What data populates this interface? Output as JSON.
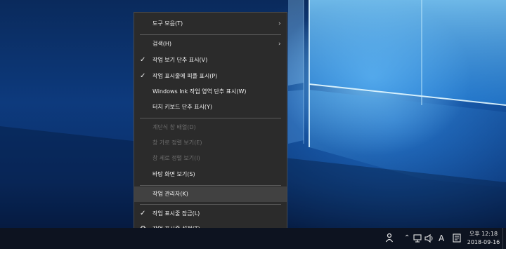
{
  "context_menu": {
    "items": [
      {
        "label": "도구 모음(T)",
        "checked": false,
        "submenu": true,
        "disabled": false
      },
      {
        "label": "검색(H)",
        "checked": false,
        "submenu": true,
        "disabled": false
      },
      {
        "label": "작업 보기 단추 표시(V)",
        "checked": true,
        "submenu": false,
        "disabled": false
      },
      {
        "label": "작업 표시줄에 피플 표시(P)",
        "checked": true,
        "submenu": false,
        "disabled": false
      },
      {
        "label": "Windows Ink 작업 영역 단추 표시(W)",
        "checked": false,
        "submenu": false,
        "disabled": false
      },
      {
        "label": "터치 키보드 단추 표시(Y)",
        "checked": false,
        "submenu": false,
        "disabled": false
      },
      {
        "label": "계단식 창 배열(D)",
        "checked": false,
        "submenu": false,
        "disabled": true
      },
      {
        "label": "창 가로 정렬 보기(E)",
        "checked": false,
        "submenu": false,
        "disabled": true
      },
      {
        "label": "창 세로 정렬 보기(I)",
        "checked": false,
        "submenu": false,
        "disabled": true
      },
      {
        "label": "바탕 화면 보기(S)",
        "checked": false,
        "submenu": false,
        "disabled": false
      },
      {
        "label": "작업 관리자(K)",
        "checked": false,
        "submenu": false,
        "disabled": false,
        "highlighted": true
      },
      {
        "label": "작업 표시줄 잠금(L)",
        "checked": true,
        "submenu": false,
        "disabled": false
      },
      {
        "label": "작업 표시줄 설정(T)",
        "checked": false,
        "submenu": false,
        "disabled": false,
        "icon": "gear-icon"
      }
    ]
  },
  "taskbar": {
    "ime_label": "A",
    "clock": {
      "time": "오후 12:18",
      "date": "2018-09-16"
    }
  },
  "icons": {
    "check": "✓",
    "submenu_arrow": "›",
    "gear": "⚙",
    "tray_up": "⌃",
    "people": "person-icon",
    "network": "network-icon",
    "volume": "volume-icon",
    "notifications": "notification-icon"
  },
  "colors": {
    "menu_bg": "#2b2b2b",
    "menu_highlight": "#414141",
    "taskbar_bg": "#0d1320",
    "disabled_text": "#6e6e6e"
  }
}
